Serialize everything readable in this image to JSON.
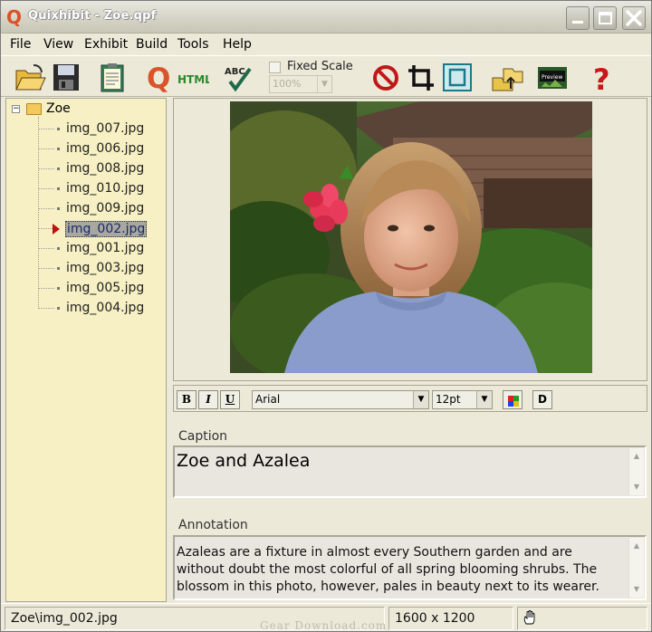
{
  "window": {
    "title": "Quixhibit - Zoe.qpf",
    "app_icon_glyph": "Q"
  },
  "menu": [
    "File",
    "View",
    "Exhibit",
    "Build",
    "Tools",
    "Help"
  ],
  "toolbar": {
    "buttons": [
      "open-folder-icon",
      "save-disk-icon",
      "clipboard-icon",
      "quixhibit-q-icon",
      "html-icon",
      "spellcheck-icon",
      "no-entry-icon",
      "crop-icon",
      "frame-icon",
      "export-folder-icon",
      "preview-icon",
      "help-icon"
    ],
    "html_label": "HTML",
    "abc_label": "ABC",
    "preview_label": "Preview",
    "help_glyph": "?",
    "fixed_scale_label": "Fixed Scale",
    "fixed_scale_checked": false,
    "scale_value": "100%"
  },
  "tree": {
    "root": "Zoe",
    "items": [
      "img_007.jpg",
      "img_006.jpg",
      "img_008.jpg",
      "img_010.jpg",
      "img_009.jpg",
      "img_002.jpg",
      "img_001.jpg",
      "img_003.jpg",
      "img_005.jpg",
      "img_004.jpg"
    ],
    "selected_index": 5
  },
  "format_bar": {
    "bold": "B",
    "italic": "I",
    "underline": "U",
    "font": "Arial",
    "size": "12pt",
    "default_label": "D"
  },
  "caption": {
    "label": "Caption",
    "text": "Zoe and Azalea"
  },
  "annotation": {
    "label": "Annotation",
    "text": "Azaleas are a fixture in almost every Southern garden and are without doubt the most colorful of all spring blooming shrubs. The blossom in this photo, however, pales in beauty next to its wearer."
  },
  "status": {
    "path": "Zoe\\img_002.jpg",
    "dimensions": "1600 x 1200"
  },
  "watermark": "Gear Download.com",
  "colors": {
    "tree_bg": "#f7f0c4",
    "window_bg": "#ece9d8",
    "selected_marker": "#c01010"
  }
}
